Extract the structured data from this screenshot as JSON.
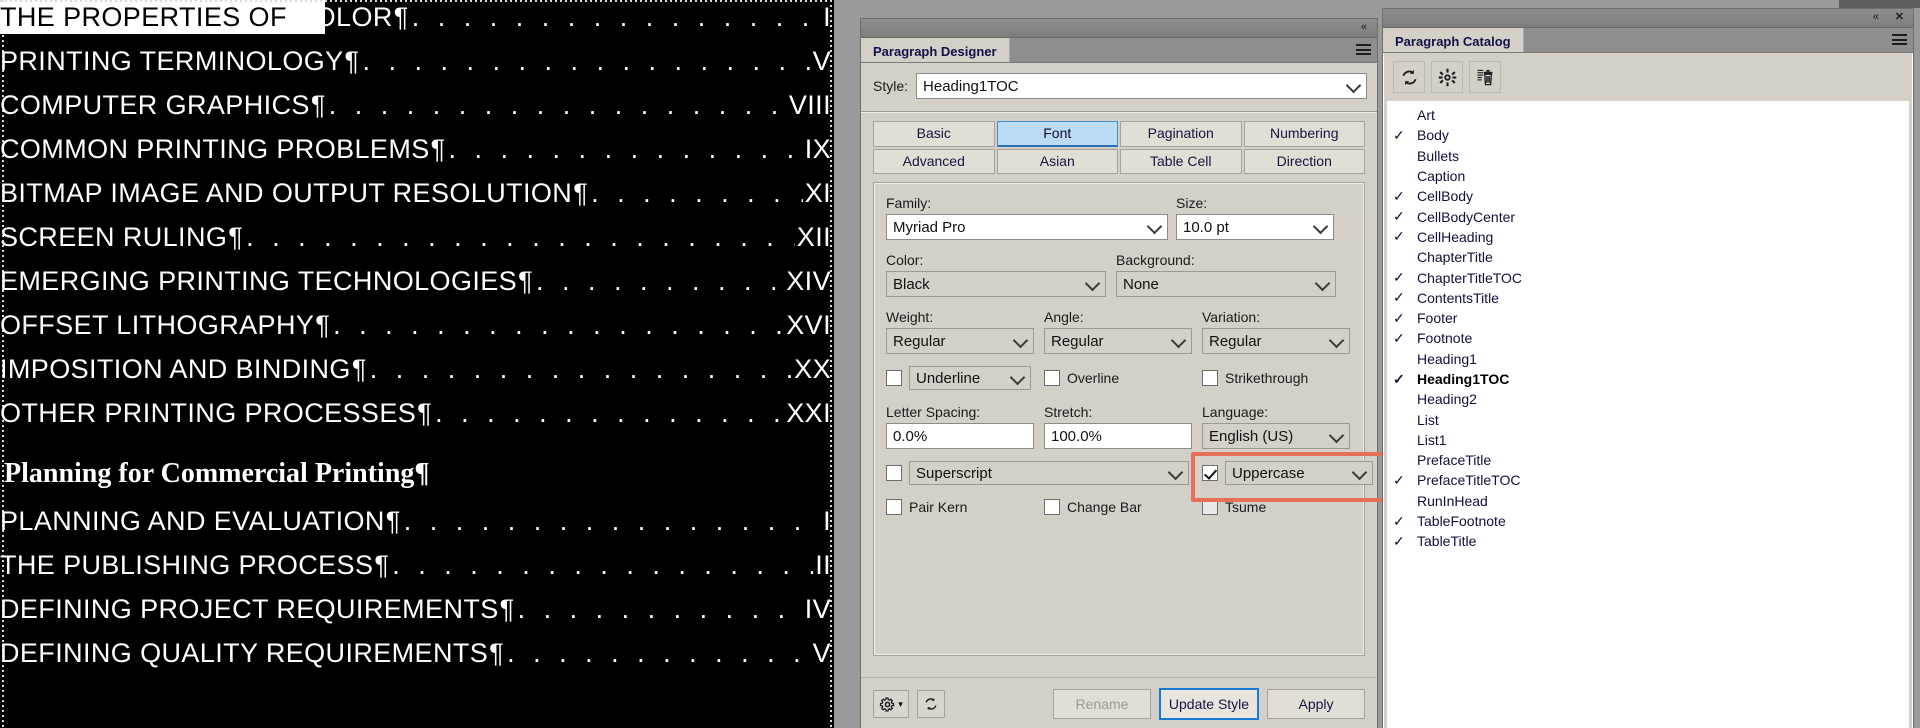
{
  "document": {
    "name": "toc-document",
    "highlighted_text": "THE PROPERTIES OF",
    "entries": [
      {
        "title": "THE PROPERTIES OF COLOR",
        "page": "I"
      },
      {
        "title": "PRINTING TERMINOLOGY",
        "page": "V"
      },
      {
        "title": "COMPUTER GRAPHICS",
        "page": "VIII"
      },
      {
        "title": "COMMON PRINTING PROBLEMS",
        "page": "IX"
      },
      {
        "title": "BITMAP IMAGE AND OUTPUT RESOLUTION",
        "page": "XI"
      },
      {
        "title": "SCREEN RULING",
        "page": "XII"
      },
      {
        "title": "EMERGING PRINTING TECHNOLOGIES",
        "page": "XIV"
      },
      {
        "title": "OFFSET LITHOGRAPHY",
        "page": "XVI"
      },
      {
        "title": "IMPOSITION AND BINDING",
        "page": "XX"
      },
      {
        "title": "OTHER PRINTING PROCESSES",
        "page": "XXI"
      }
    ],
    "section_heading": "Planning for Commercial Printing¶",
    "entries2": [
      {
        "title": "PLANNING AND EVALUATION",
        "page": "I"
      },
      {
        "title": "THE PUBLISHING PROCESS",
        "page": "II"
      },
      {
        "title": "DEFINING PROJECT REQUIREMENTS",
        "page": "IV"
      },
      {
        "title": "DEFINING QUALITY REQUIREMENTS",
        "page": "V"
      }
    ],
    "pilcrow": "¶",
    "leader_dots": ". . . . . . . . . . . . . . . . . . . . . . . . . . . . . . . . . . . . . . . . . . . . . . . . . . . . ."
  },
  "paragraph_designer": {
    "tab_label": "Paragraph Designer",
    "collapse_label": "«",
    "style_label": "Style:",
    "style_value": "Heading1TOC",
    "tabs_row1": [
      {
        "label": "Basic",
        "active": false
      },
      {
        "label": "Font",
        "active": true
      },
      {
        "label": "Pagination",
        "active": false
      },
      {
        "label": "Numbering",
        "active": false
      }
    ],
    "tabs_row2": [
      {
        "label": "Advanced",
        "active": false
      },
      {
        "label": "Asian",
        "active": false
      },
      {
        "label": "Table Cell",
        "active": false
      },
      {
        "label": "Direction",
        "active": false
      }
    ],
    "font": {
      "family_label": "Family:",
      "family_value": "Myriad Pro",
      "size_label": "Size:",
      "size_value": "10.0 pt",
      "color_label": "Color:",
      "color_value": "Black",
      "background_label": "Background:",
      "background_value": "None",
      "weight_label": "Weight:",
      "weight_value": "Regular",
      "angle_label": "Angle:",
      "angle_value": "Regular",
      "variation_label": "Variation:",
      "variation_value": "Regular",
      "underline_label": "Underline",
      "underline_checked": false,
      "overline_label": "Overline",
      "overline_checked": false,
      "strikethrough_label": "Strikethrough",
      "strikethrough_checked": false,
      "letter_spacing_label": "Letter Spacing:",
      "letter_spacing_value": "0.0%",
      "stretch_label": "Stretch:",
      "stretch_value": "100.0%",
      "language_label": "Language:",
      "language_value": "English (US)",
      "superscript_label": "Superscript",
      "superscript_checked": false,
      "capitalization_label": "Uppercase",
      "capitalization_checked": true,
      "pair_kern_label": "Pair Kern",
      "pair_kern_checked": false,
      "change_bar_label": "Change Bar",
      "change_bar_checked": false,
      "tsume_label": "Tsume",
      "tsume_checked": false
    },
    "footer": {
      "rename_label": "Rename",
      "update_style_label": "Update Style",
      "apply_label": "Apply"
    },
    "highlight_color": "#e8705a"
  },
  "paragraph_catalog": {
    "tab_label": "Paragraph Catalog",
    "collapse_label": "«",
    "close_label": "✕",
    "tools": [
      {
        "name": "refresh-icon"
      },
      {
        "name": "gear-icon"
      },
      {
        "name": "delete-icon"
      }
    ],
    "items": [
      {
        "label": "Art",
        "checked": false,
        "selected": false
      },
      {
        "label": "Body",
        "checked": true,
        "selected": false
      },
      {
        "label": "Bullets",
        "checked": false,
        "selected": false
      },
      {
        "label": "Caption",
        "checked": false,
        "selected": false
      },
      {
        "label": "CellBody",
        "checked": true,
        "selected": false
      },
      {
        "label": "CellBodyCenter",
        "checked": true,
        "selected": false
      },
      {
        "label": "CellHeading",
        "checked": true,
        "selected": false
      },
      {
        "label": "ChapterTitle",
        "checked": false,
        "selected": false
      },
      {
        "label": "ChapterTitleTOC",
        "checked": true,
        "selected": false
      },
      {
        "label": "ContentsTitle",
        "checked": true,
        "selected": false
      },
      {
        "label": "Footer",
        "checked": true,
        "selected": false
      },
      {
        "label": "Footnote",
        "checked": true,
        "selected": false
      },
      {
        "label": "Heading1",
        "checked": false,
        "selected": false
      },
      {
        "label": "Heading1TOC",
        "checked": true,
        "selected": true
      },
      {
        "label": "Heading2",
        "checked": false,
        "selected": false
      },
      {
        "label": "List",
        "checked": false,
        "selected": false
      },
      {
        "label": "List1",
        "checked": false,
        "selected": false
      },
      {
        "label": "PrefaceTitle",
        "checked": false,
        "selected": false
      },
      {
        "label": "PrefaceTitleTOC",
        "checked": true,
        "selected": false
      },
      {
        "label": "RunInHead",
        "checked": false,
        "selected": false
      },
      {
        "label": "TableFootnote",
        "checked": true,
        "selected": false
      },
      {
        "label": "TableTitle",
        "checked": true,
        "selected": false
      }
    ],
    "check_glyph": "✓"
  }
}
